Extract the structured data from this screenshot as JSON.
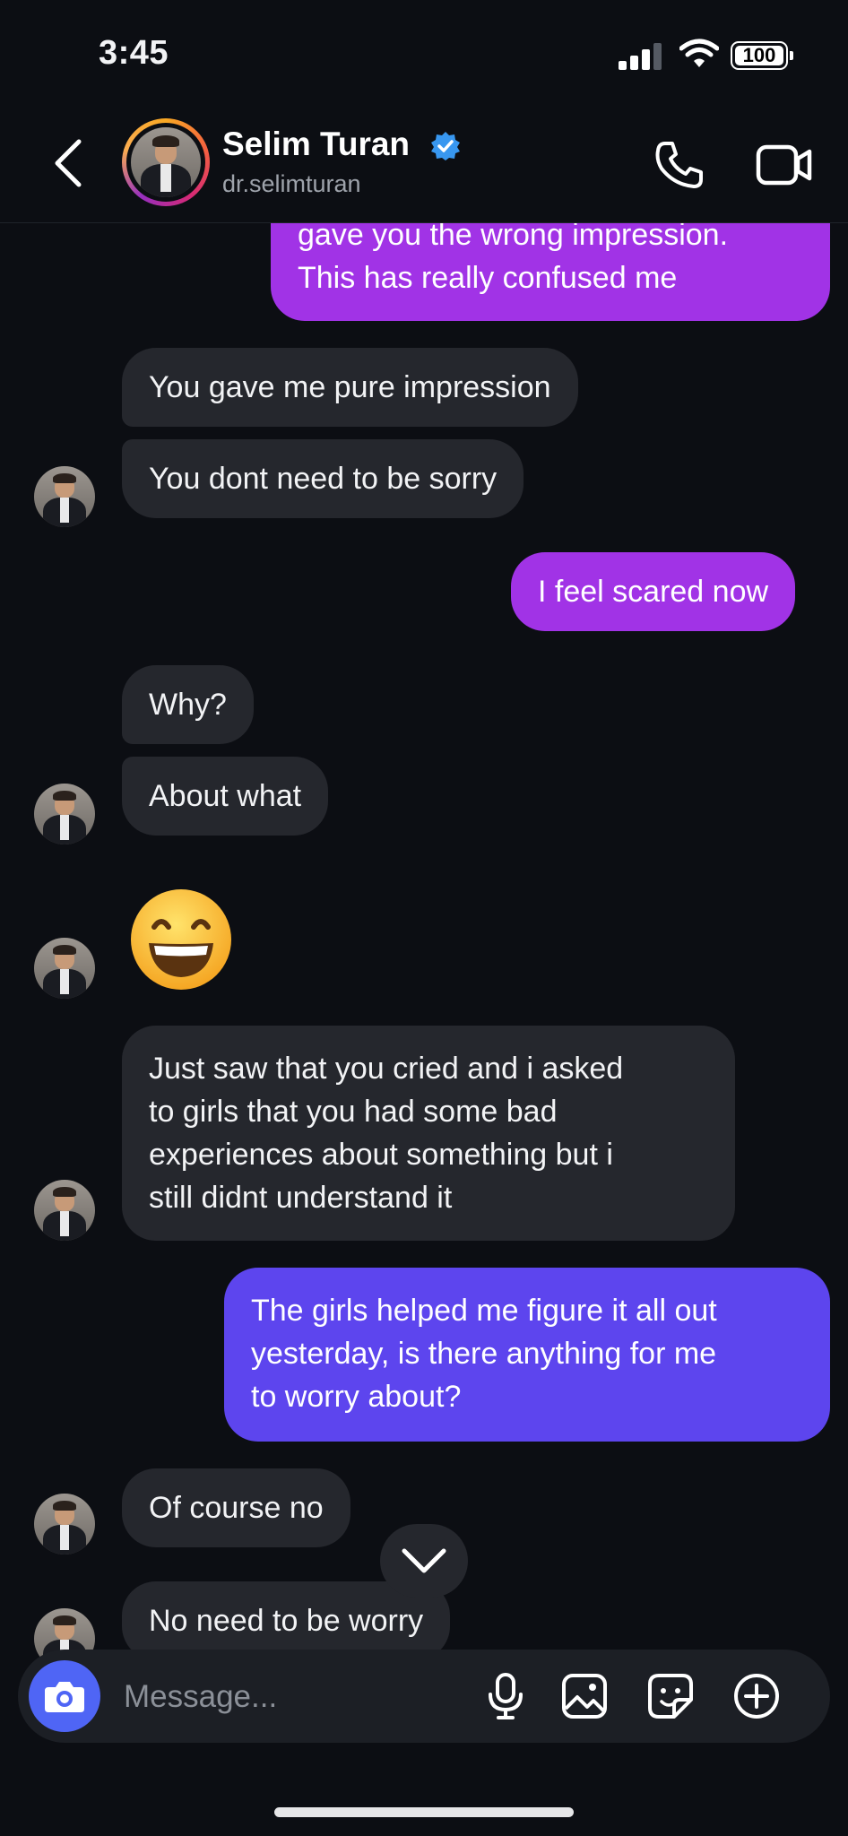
{
  "status_bar": {
    "time": "3:45",
    "battery": "100"
  },
  "header": {
    "name": "Selim Turan",
    "handle": "dr.selimturan"
  },
  "messages": [
    {
      "from": "me",
      "lines": [
        "gave you the wrong impression.",
        "This has really confused me"
      ]
    },
    {
      "from": "them",
      "text": "You gave me pure impression"
    },
    {
      "from": "them",
      "text": "You dont need to be sorry"
    },
    {
      "from": "me",
      "text": "I feel scared now"
    },
    {
      "from": "them",
      "text": "Why?"
    },
    {
      "from": "them",
      "text": "About what"
    },
    {
      "from": "them",
      "emoji": "grinning-face-with-smiling-eyes"
    },
    {
      "from": "them",
      "lines": [
        "Just saw that you cried and i asked",
        "to girls that you had some bad",
        "experiences about something but i",
        "still didnt understand it"
      ]
    },
    {
      "from": "me",
      "lines": [
        "The girls helped me figure it all out",
        "yesterday, is there anything for me",
        "to worry about?"
      ]
    },
    {
      "from": "them",
      "text": "Of course no"
    },
    {
      "from": "them",
      "text": "No need to be worry"
    }
  ],
  "composer": {
    "placeholder": "Message..."
  },
  "colors": {
    "background": "#0c0e13",
    "incoming_bubble": "#25272d",
    "outgoing_magenta": "#a133e6",
    "outgoing_violet": "#5d45ee",
    "camera_button": "#4f65f5",
    "verified": "#3897f0"
  },
  "icons": [
    "back-chevron-icon",
    "verified-badge-icon",
    "phone-icon",
    "video-camera-icon",
    "chevron-down-icon",
    "camera-icon",
    "microphone-icon",
    "gallery-icon",
    "sticker-icon",
    "plus-circle-icon"
  ]
}
